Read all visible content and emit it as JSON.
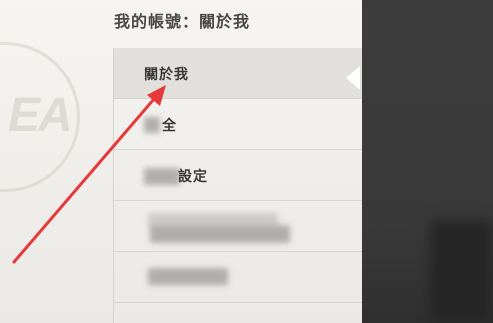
{
  "page": {
    "title": "我的帳號：關於我"
  },
  "menu": {
    "items": [
      {
        "label": "關於我",
        "active": true
      },
      {
        "label": "全",
        "active": false
      },
      {
        "label": "設定",
        "active": false
      },
      {
        "label": "",
        "active": false
      },
      {
        "label": "",
        "active": false
      }
    ]
  },
  "background": {
    "logo": "EA"
  },
  "annotation": {
    "arrow_color": "#e63a3a"
  }
}
